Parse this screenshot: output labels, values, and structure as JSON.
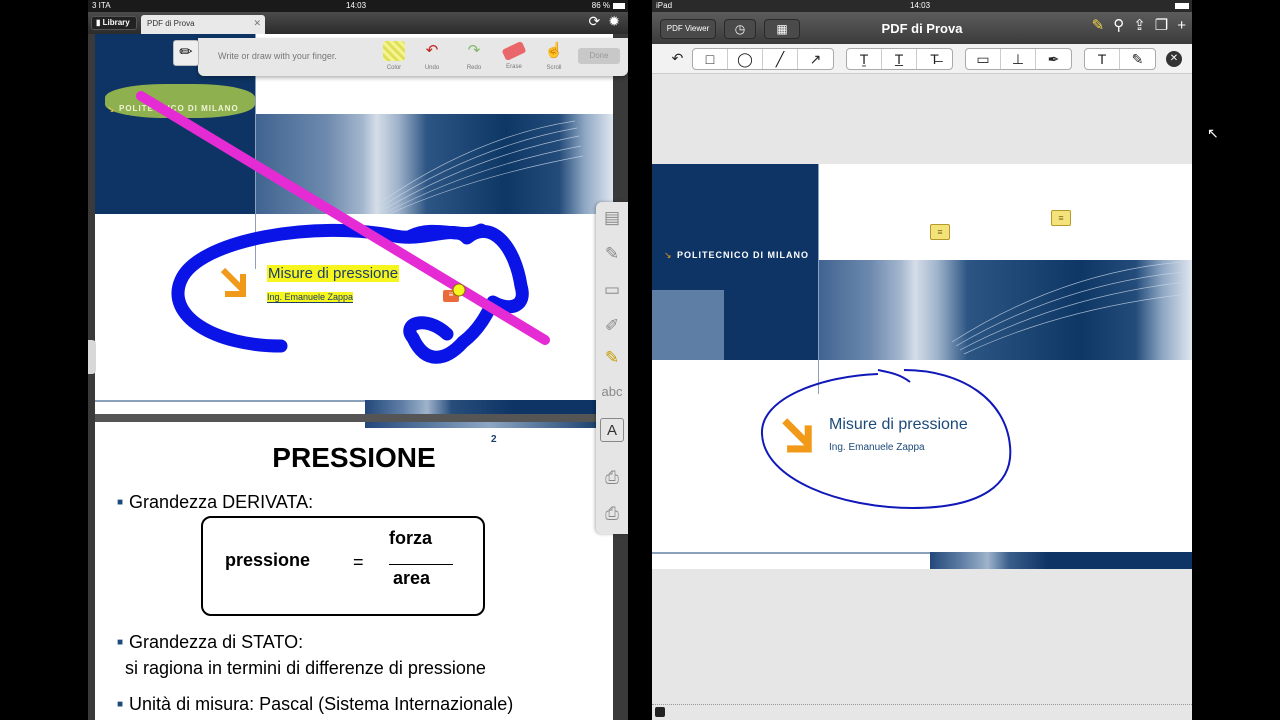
{
  "left": {
    "status": {
      "carrier": "3 ITA",
      "time": "14:03",
      "battery": "86 %"
    },
    "tabs": {
      "library": "Library",
      "document": "PDF di Prova"
    },
    "draw_toolbar": {
      "hint": "Write or draw with your finger.",
      "buttons": [
        "Color",
        "Undo",
        "Redo",
        "Erase",
        "Scroll"
      ],
      "done": "Done"
    },
    "page1": {
      "university": "POLITECNICO DI MILANO",
      "title": "Misure di pressione",
      "author": "Ing. Emanuele Zappa"
    },
    "page2": {
      "page_number": "2",
      "heading": "PRESSIONE",
      "bullet1": "Grandezza DERIVATA:",
      "formula_lhs": "pressione",
      "formula_eq": "=",
      "formula_num": "forza",
      "formula_den": "area",
      "bullet2_line1": "Grandezza di STATO:",
      "bullet2_line2": "si ragiona in termini di differenze di pressione",
      "bullet3": "Unità di misura: Pascal (Sistema Internazionale)"
    },
    "side_tools": [
      "note-tool",
      "pen-tool",
      "ruler-tool",
      "pencil-tool",
      "highlighter-tool",
      "abc",
      "text-box-tool",
      "stamp-tool",
      "printer-tool"
    ]
  },
  "right": {
    "status": {
      "device": "iPad",
      "time": "14:03"
    },
    "nav": {
      "back": "PDF Viewer",
      "title": "PDF di Prova"
    },
    "toolbar_groups": [
      [
        "undo-icon"
      ],
      [
        "rectangle-icon",
        "ellipse-icon",
        "line-icon",
        "arrow-icon"
      ],
      [
        "text-underline-box-icon",
        "underline-icon",
        "strikeout-icon"
      ],
      [
        "comment-icon",
        "stamp-icon",
        "pen-nib-icon"
      ],
      [
        "text-icon",
        "freehand-icon"
      ]
    ],
    "page": {
      "university": "POLITECNICO DI MILANO",
      "title": "Misure di pressione",
      "author": "Ing. Emanuele Zappa"
    }
  },
  "colors": {
    "dark_blue": "#0d3464",
    "orange_arrow": "#f19a1a",
    "highlight_yellow": "#f6f51d",
    "blue_ink": "#0a14e6",
    "magenta_ink": "#e52bd4"
  }
}
